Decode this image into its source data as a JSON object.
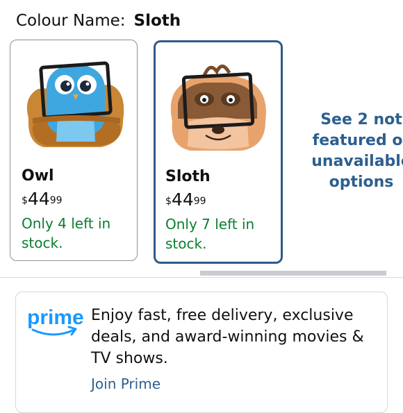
{
  "colour": {
    "label": "Colour Name:",
    "selected": "Sloth"
  },
  "swatches": [
    {
      "name": "Owl",
      "image": "owl-tablet-pillow",
      "price": {
        "currency": "$",
        "whole": "44",
        "fraction": "99"
      },
      "stock": "Only 4 left in stock.",
      "selected": false
    },
    {
      "name": "Sloth",
      "image": "sloth-tablet-pillow",
      "price": {
        "currency": "$",
        "whole": "44",
        "fraction": "99"
      },
      "stock": "Only 7 left in stock.",
      "selected": true
    }
  ],
  "more_options": {
    "line1": "See 2 not",
    "line2": "featured or",
    "line3": "unavailable",
    "line4": "options"
  },
  "prime": {
    "logo_text": "prime",
    "message": "Enjoy fast, free delivery, exclusive deals, and award-winning movies & TV shows.",
    "link": "Join Prime"
  },
  "colors": {
    "text": "#0f1111",
    "stock_green": "#0a7e2e",
    "link_blue": "#2c5f8f",
    "selected_border": "#2f5a8a",
    "prime_blue": "#1a98ff"
  }
}
